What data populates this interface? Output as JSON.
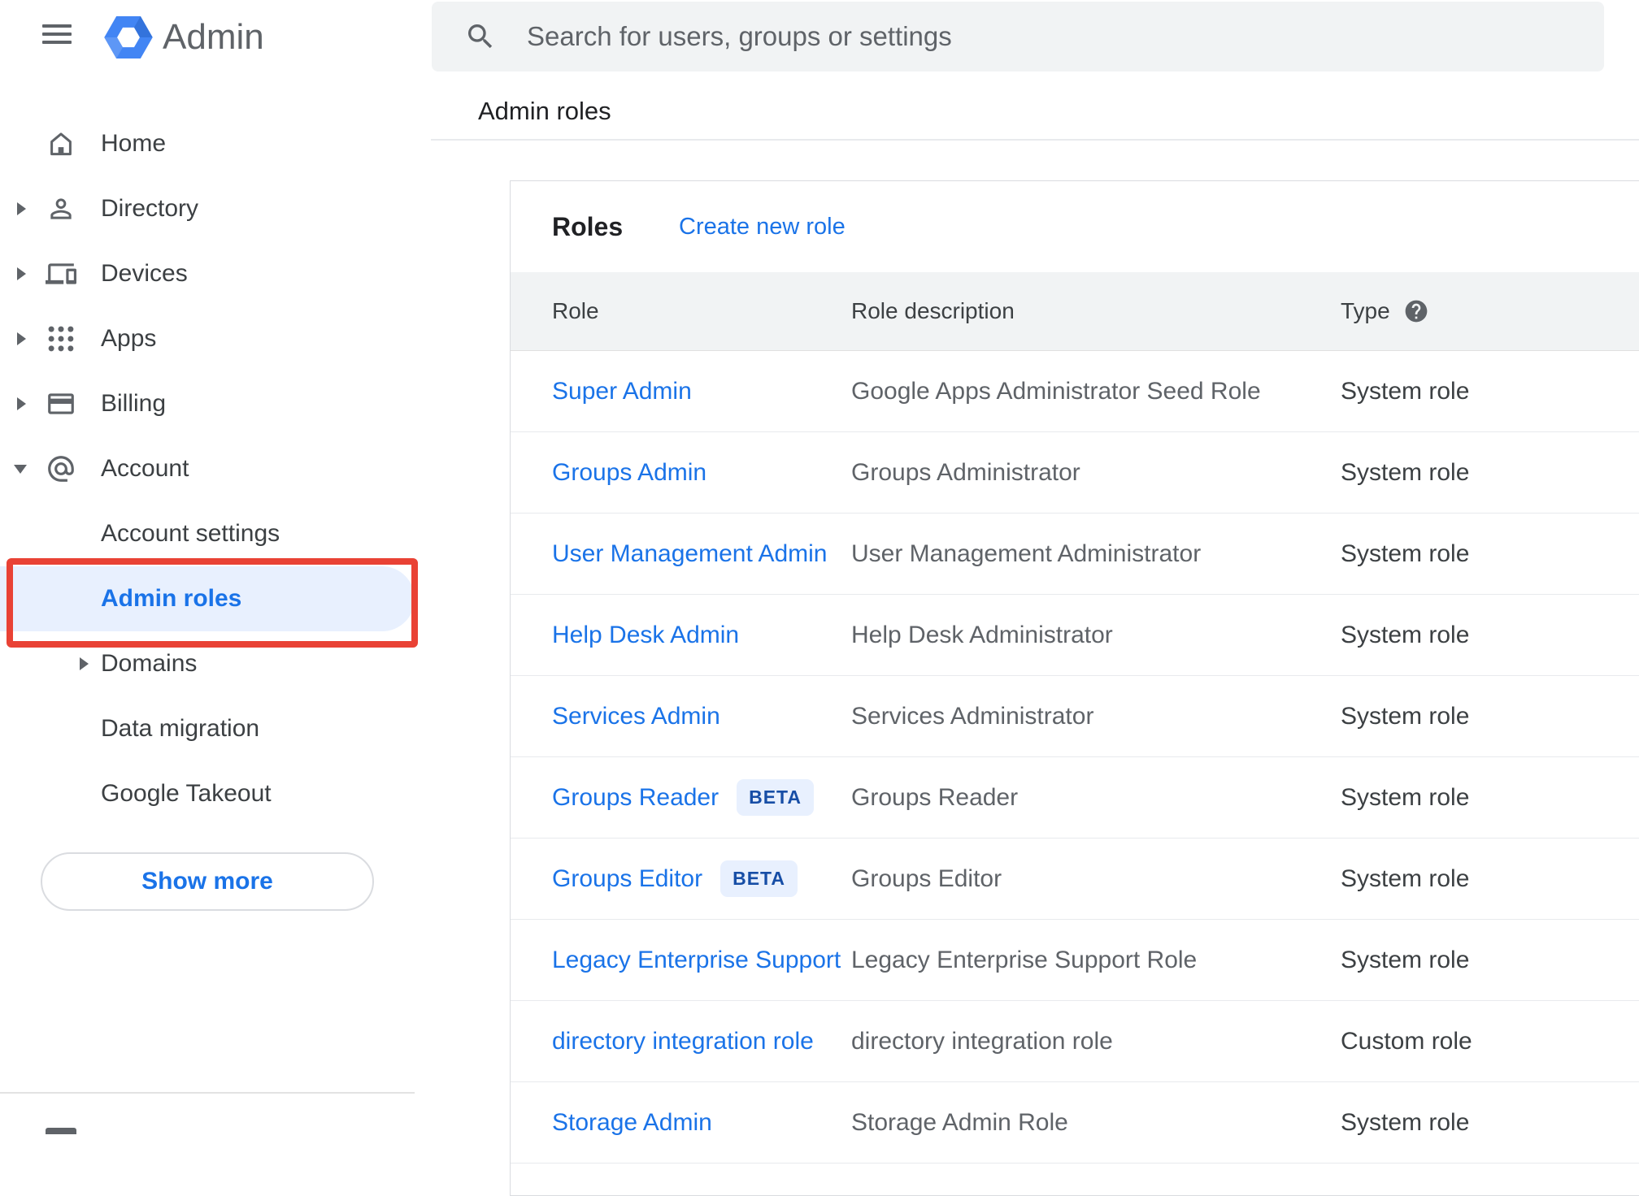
{
  "app": {
    "name": "Admin"
  },
  "colors": {
    "accent": "#1a73e8",
    "selected_bg": "#e8f0fe",
    "annotation_box": "#e94235",
    "beta_text": "#174ea6"
  },
  "sidebar": {
    "items": [
      {
        "label": "Home",
        "icon": "home-icon",
        "arrow": "none"
      },
      {
        "label": "Directory",
        "icon": "person-icon",
        "arrow": "right"
      },
      {
        "label": "Devices",
        "icon": "devices-icon",
        "arrow": "right"
      },
      {
        "label": "Apps",
        "icon": "apps-grid-icon",
        "arrow": "right"
      },
      {
        "label": "Billing",
        "icon": "credit-card-icon",
        "arrow": "right"
      },
      {
        "label": "Account",
        "icon": "at-sign-icon",
        "arrow": "down"
      }
    ],
    "account_children": [
      {
        "label": "Account settings",
        "arrow": "none",
        "selected": false
      },
      {
        "label": "Admin roles",
        "arrow": "none",
        "selected": true
      },
      {
        "label": "Domains",
        "arrow": "right",
        "selected": false
      },
      {
        "label": "Data migration",
        "arrow": "none",
        "selected": false
      },
      {
        "label": "Google Takeout",
        "arrow": "none",
        "selected": false
      }
    ],
    "show_more_label": "Show more"
  },
  "search": {
    "placeholder": "Search for users, groups or settings"
  },
  "breadcrumb": {
    "title": "Admin roles"
  },
  "roles_card": {
    "title": "Roles",
    "create_link_label": "Create new role",
    "columns": [
      "Role",
      "Role description",
      "Type"
    ],
    "beta_label": "BETA",
    "rows": [
      {
        "role": "Super Admin",
        "beta": false,
        "description": "Google Apps Administrator Seed Role",
        "type": "System role"
      },
      {
        "role": "Groups Admin",
        "beta": false,
        "description": "Groups Administrator",
        "type": "System role"
      },
      {
        "role": "User Management Admin",
        "beta": false,
        "description": "User Management Administrator",
        "type": "System role"
      },
      {
        "role": "Help Desk Admin",
        "beta": false,
        "description": "Help Desk Administrator",
        "type": "System role"
      },
      {
        "role": "Services Admin",
        "beta": false,
        "description": "Services Administrator",
        "type": "System role"
      },
      {
        "role": "Groups Reader",
        "beta": true,
        "description": "Groups Reader",
        "type": "System role"
      },
      {
        "role": "Groups Editor",
        "beta": true,
        "description": "Groups Editor",
        "type": "System role"
      },
      {
        "role": "Legacy Enterprise Support",
        "beta": false,
        "description": "Legacy Enterprise Support Role",
        "type": "System role"
      },
      {
        "role": "directory integration role",
        "beta": false,
        "description": "directory integration role",
        "type": "Custom role"
      },
      {
        "role": "Storage Admin",
        "beta": false,
        "description": "Storage Admin Role",
        "type": "System role"
      }
    ]
  }
}
